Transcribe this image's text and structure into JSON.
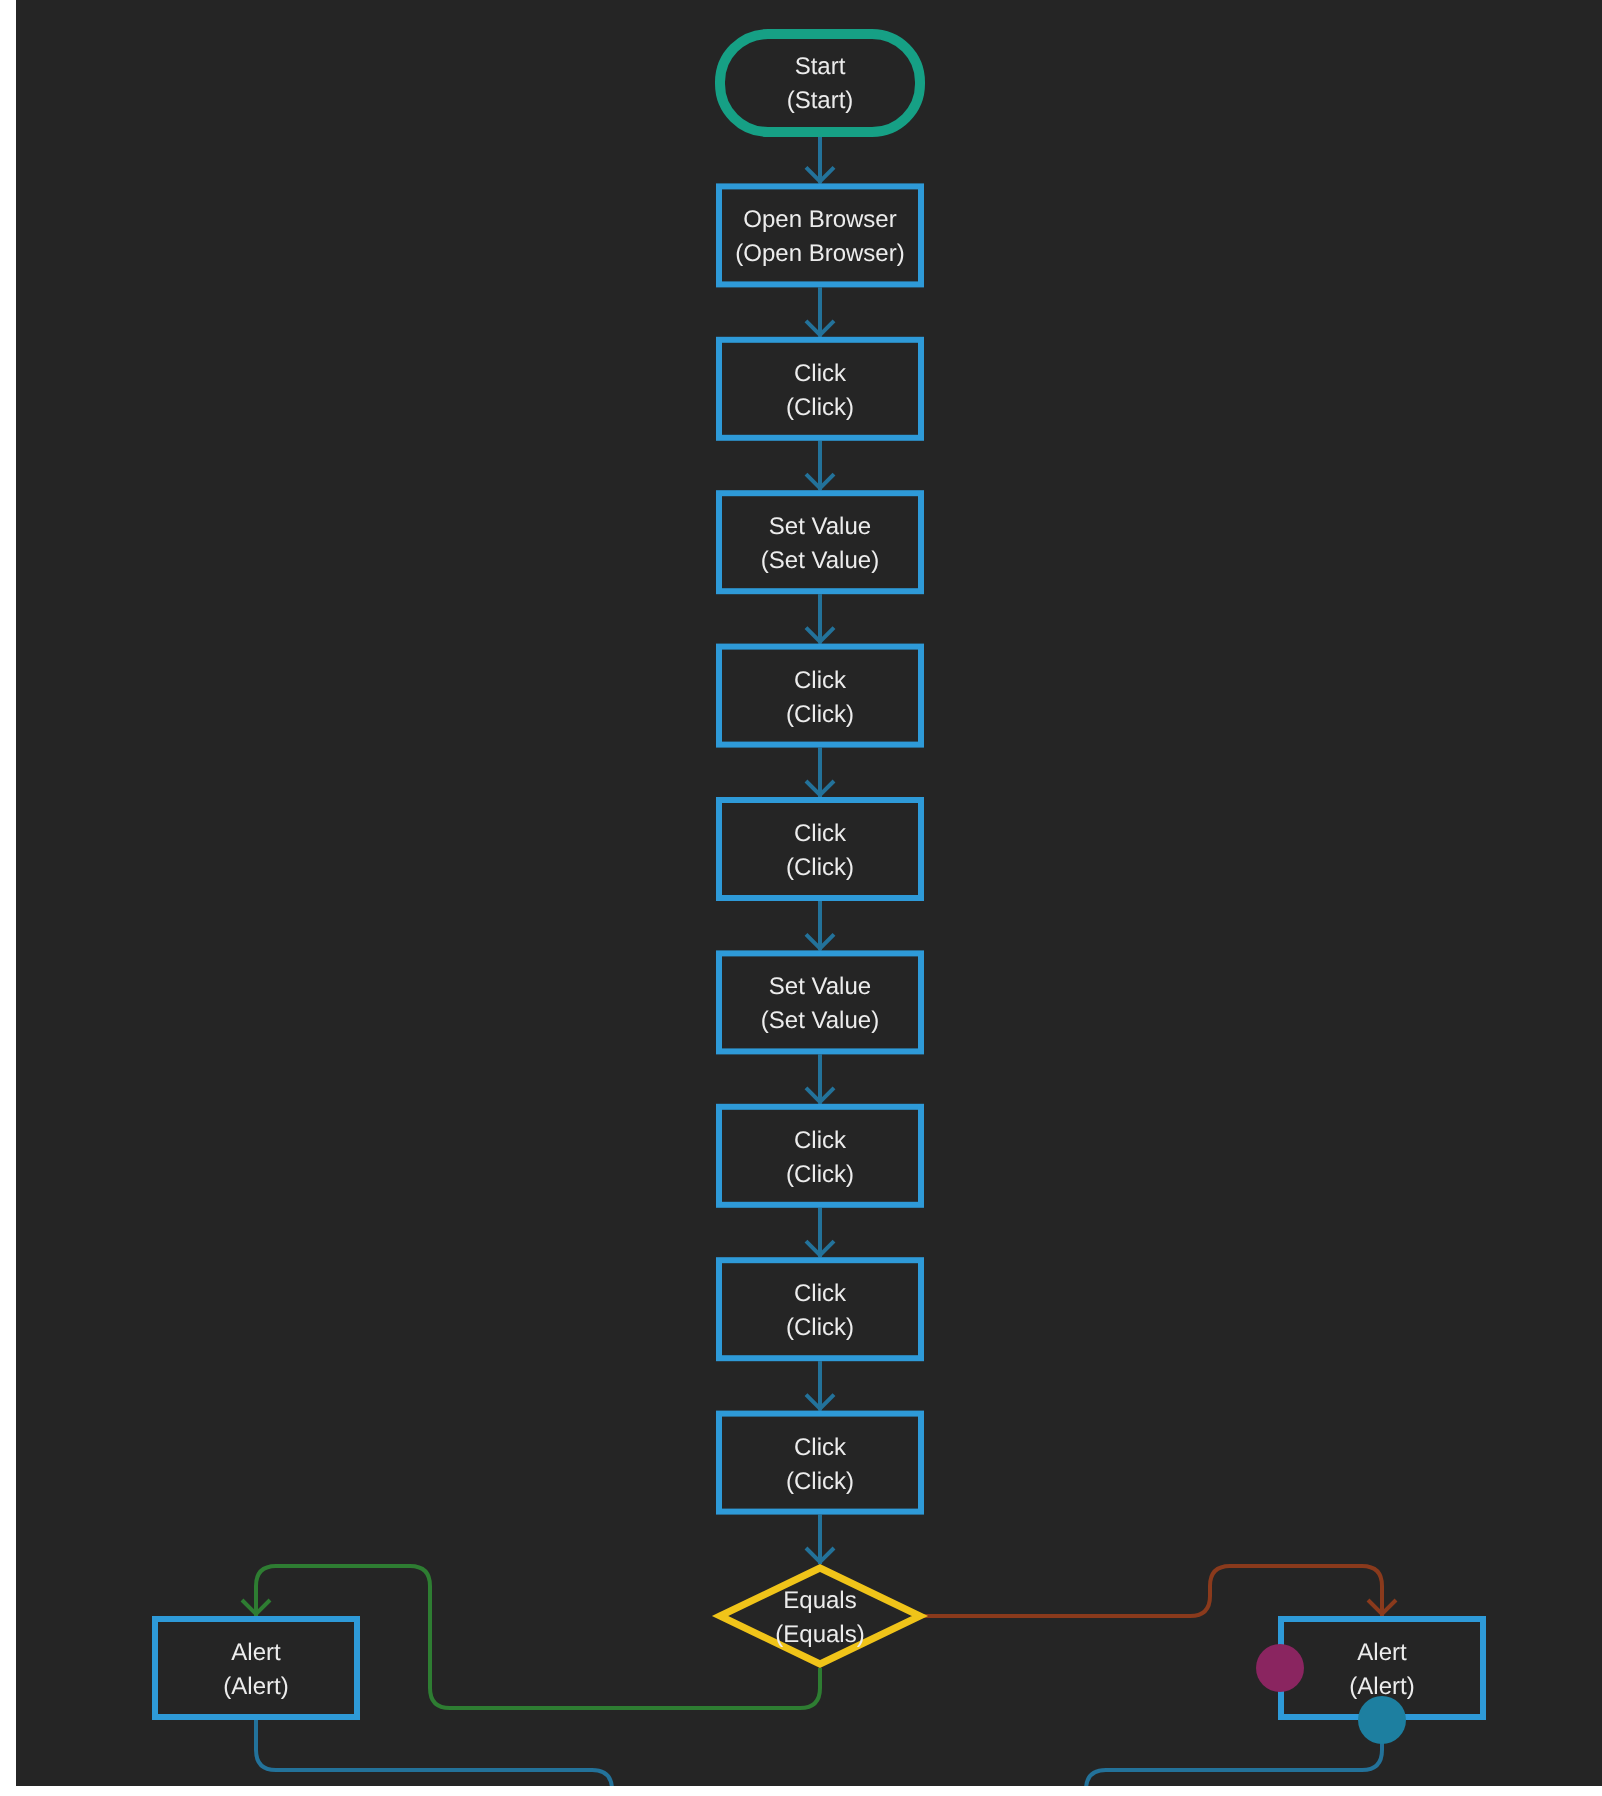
{
  "nodes": [
    {
      "kind": "terminal",
      "title": "Start",
      "subtitle": "(Start)"
    },
    {
      "kind": "action",
      "title": "Open Browser",
      "subtitle": "(Open Browser)"
    },
    {
      "kind": "action",
      "title": "Click",
      "subtitle": "(Click)"
    },
    {
      "kind": "action",
      "title": "Set Value",
      "subtitle": "(Set Value)"
    },
    {
      "kind": "action",
      "title": "Click",
      "subtitle": "(Click)"
    },
    {
      "kind": "action",
      "title": "Click",
      "subtitle": "(Click)"
    },
    {
      "kind": "action",
      "title": "Set Value",
      "subtitle": "(Set Value)"
    },
    {
      "kind": "action",
      "title": "Click",
      "subtitle": "(Click)"
    },
    {
      "kind": "action",
      "title": "Click",
      "subtitle": "(Click)"
    },
    {
      "kind": "action",
      "title": "Click",
      "subtitle": "(Click)"
    },
    {
      "kind": "decision",
      "title": "Equals",
      "subtitle": "(Equals)"
    }
  ],
  "branches": [
    {
      "kind": "left",
      "color": "#2e7d32",
      "node": {
        "kind": "action",
        "title": "Alert",
        "subtitle": "(Alert)"
      }
    },
    {
      "kind": "right",
      "color": "#8a3a1c",
      "node": {
        "kind": "action",
        "title": "Alert",
        "subtitle": "(Alert)"
      },
      "ports": [
        {
          "color": "#8a2560"
        },
        {
          "color": "#1d7fa0"
        }
      ]
    }
  ]
}
